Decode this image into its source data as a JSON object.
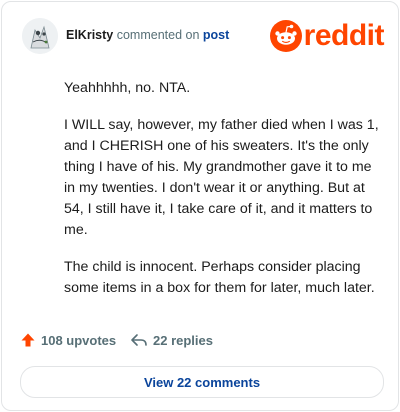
{
  "header": {
    "username": "ElKristy",
    "action": "commented on",
    "post_link": "post",
    "brand": "reddit"
  },
  "comment": {
    "paragraphs": [
      "Yeahhhhh, no. NTA.",
      "I WILL say, however, my father died when I was 1, and I CHERISH one of his sweaters. It's the only thing I have of his. My grandmother gave it to me in my twenties. I don't wear it or anything. But at 54, I still have it, I take care of it, and it matters to me.",
      "The child is innocent. Perhaps consider placing some items in a box for them for later, much later."
    ]
  },
  "footer": {
    "upvotes": "108 upvotes",
    "replies": "22 replies",
    "view_comments": "View 22 comments"
  },
  "colors": {
    "brand": "#ff4500",
    "link": "#0a449b",
    "muted": "#576f76"
  },
  "icons": {
    "upvote": "upvote-arrow-icon",
    "reply": "reply-arrow-icon",
    "logo": "reddit-snoo-icon"
  }
}
